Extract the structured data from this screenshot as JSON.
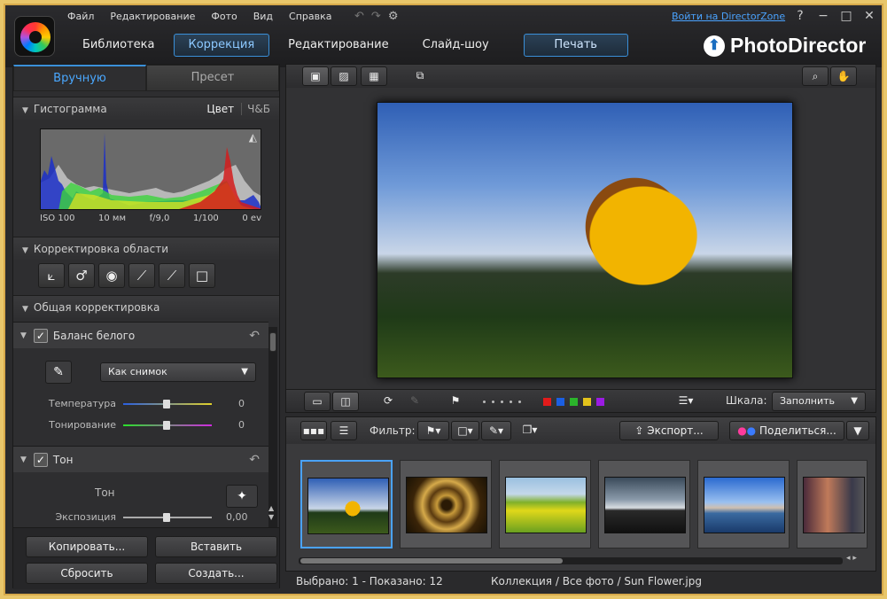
{
  "app": {
    "brand": "PhotoDirector",
    "menu": [
      "Файл",
      "Редактирование",
      "Фото",
      "Вид",
      "Справка"
    ],
    "login_link": "Войти на DirectorZone",
    "help": "?",
    "win_minimize": "−",
    "win_maximize": "□",
    "win_close": "✕"
  },
  "modes": {
    "library": "Библиотека",
    "correction": "Коррекция",
    "edit": "Редактирование",
    "slideshow": "Слайд-шоу",
    "print": "Печать"
  },
  "left_panel": {
    "tab_manual": "Вручную",
    "tab_preset": "Пресет",
    "histogram": {
      "title": "Гистограмма",
      "mode_color": "Цвет",
      "mode_bw": "Ч&Б",
      "iso": "ISO 100",
      "focal": "10 мм",
      "aperture": "f/9,0",
      "shutter": "1/100",
      "ev": "0 ev"
    },
    "area_title": "Корректировка области",
    "general_title": "Общая корректировка",
    "white_balance": {
      "title": "Баланс белого",
      "preset": "Как снимок",
      "temperature_label": "Температура",
      "temperature_value": "0",
      "tint_label": "Тонирование",
      "tint_value": "0"
    },
    "tone": {
      "title": "Тон",
      "label": "Тон",
      "exposure_label": "Экспозиция",
      "exposure_value": "0,00"
    },
    "buttons": {
      "copy": "Копировать...",
      "paste": "Вставить",
      "reset": "Сбросить",
      "create": "Создать..."
    }
  },
  "viewer": {
    "scale_label": "Шкала:",
    "scale_value": "Заполнить",
    "label_colors": [
      "#e21b1b",
      "#1b5fe2",
      "#2bb52b",
      "#e2c21b",
      "#9b1be2"
    ]
  },
  "filmstrip": {
    "filter_label": "Фильтр:",
    "export": "Экспорт...",
    "share": "Поделиться..."
  },
  "status": {
    "selection": "Выбрано: 1 - Показано: 12",
    "path": "Коллекция / Все фото / Sun Flower.jpg"
  }
}
